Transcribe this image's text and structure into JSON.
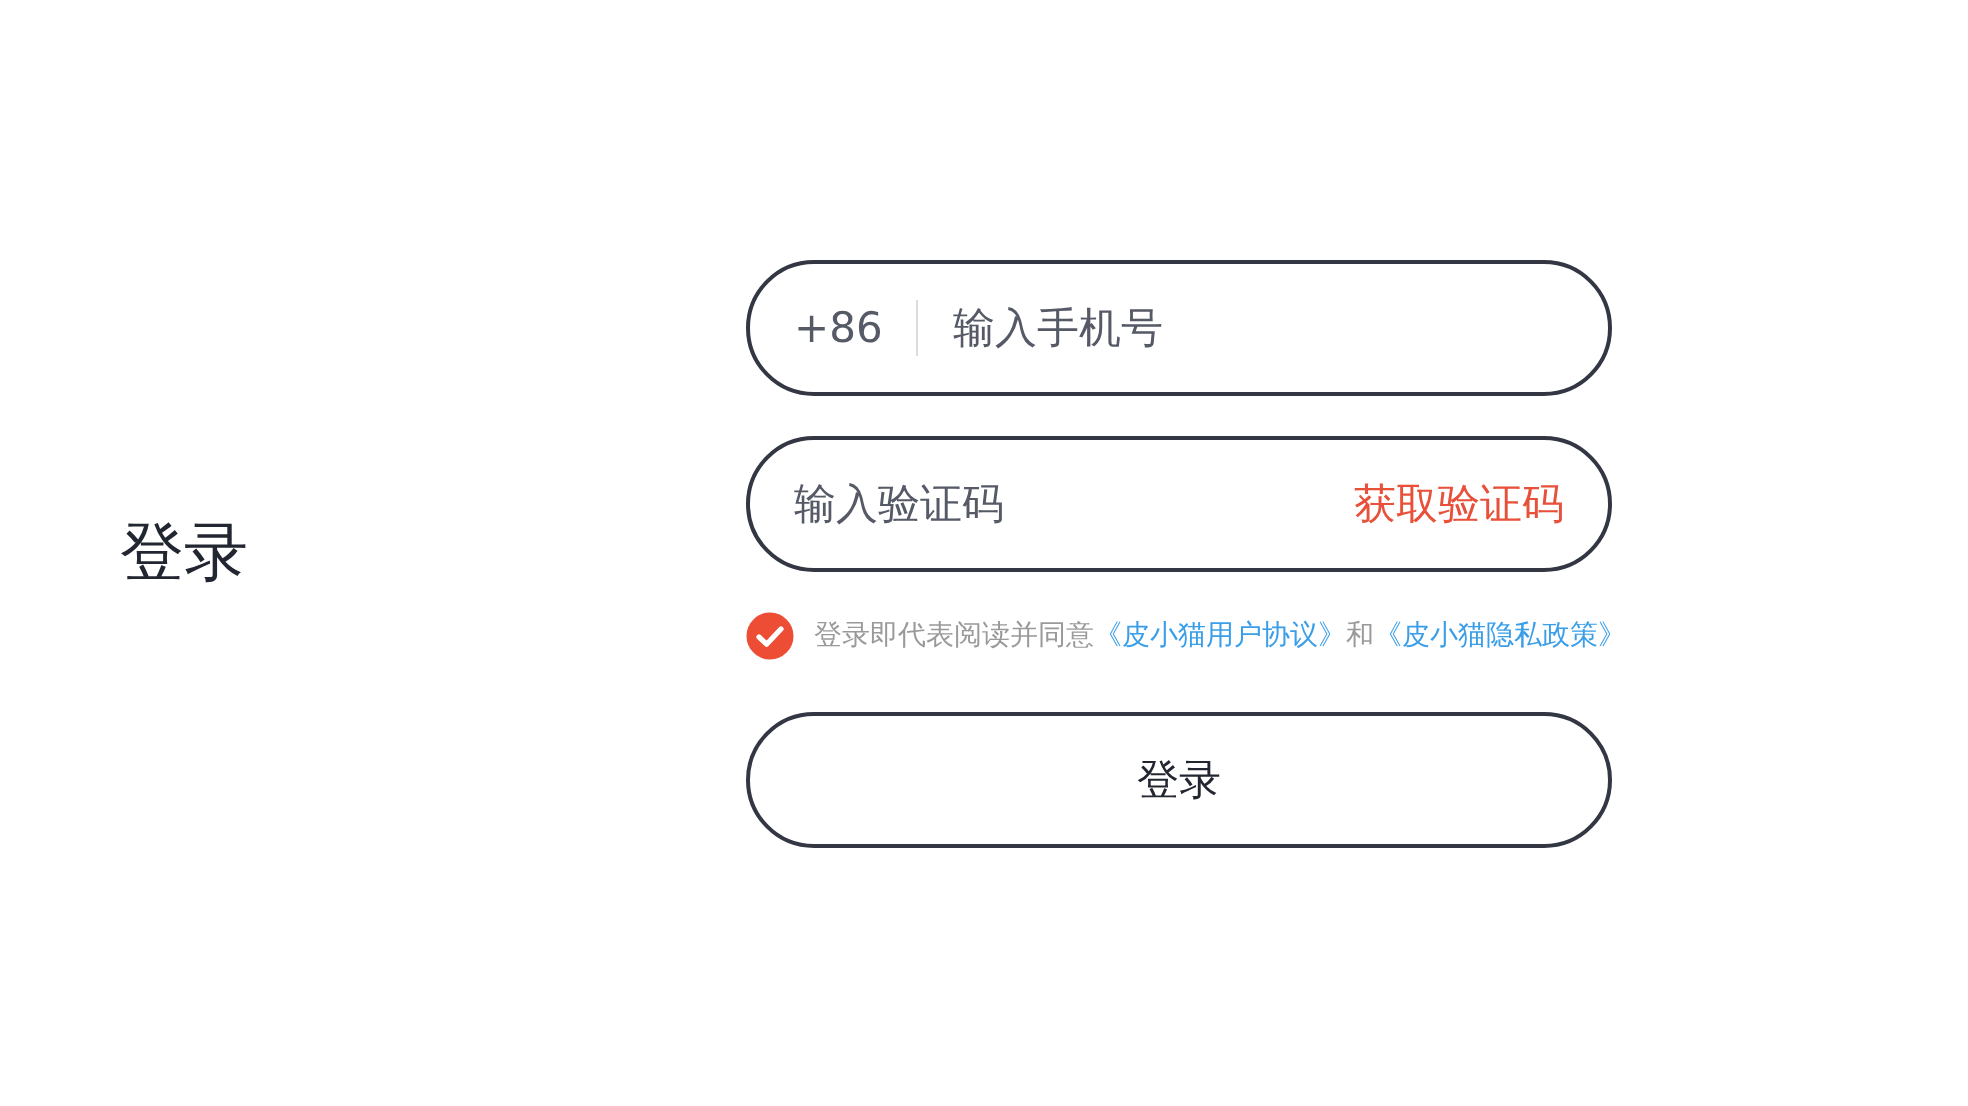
{
  "title": "登录",
  "phone": {
    "country_code": "+86",
    "placeholder": "输入手机号"
  },
  "code": {
    "placeholder": "输入验证码",
    "action": "获取验证码"
  },
  "agreement": {
    "checked": true,
    "text": "登录即代表阅读并同意",
    "links": [
      "《皮小猫用户协议》",
      "《皮小猫隐私政策》"
    ],
    "joiner": "和"
  },
  "submit": "登录"
}
